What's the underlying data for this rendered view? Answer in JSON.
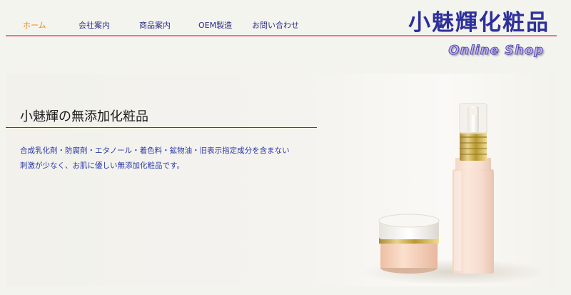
{
  "nav": {
    "items": [
      {
        "label": "ホーム",
        "active": true
      },
      {
        "label": "会社案内",
        "active": false
      },
      {
        "label": "商品案内",
        "active": false
      },
      {
        "label": "OEM製造",
        "active": false
      },
      {
        "label": "お問い合わせ",
        "active": false
      }
    ]
  },
  "logo": {
    "title": "小魅輝化粧品",
    "subtitle": "Online Shop"
  },
  "hero": {
    "title": "小魅輝の無添加化粧品",
    "description": [
      "合成乳化剤・防腐剤・エタノール・着色料・鉱物油・旧表示指定成分を含まない",
      "刺激が少なく、お肌に優しい無添加化粧品です。"
    ],
    "image_icon": "cosmetics-product-image"
  },
  "colors": {
    "nav_active": "#e88a28",
    "nav_text": "#2b2d8a",
    "nav_line": "#ec6fa3",
    "description_text": "#2c38a8"
  }
}
